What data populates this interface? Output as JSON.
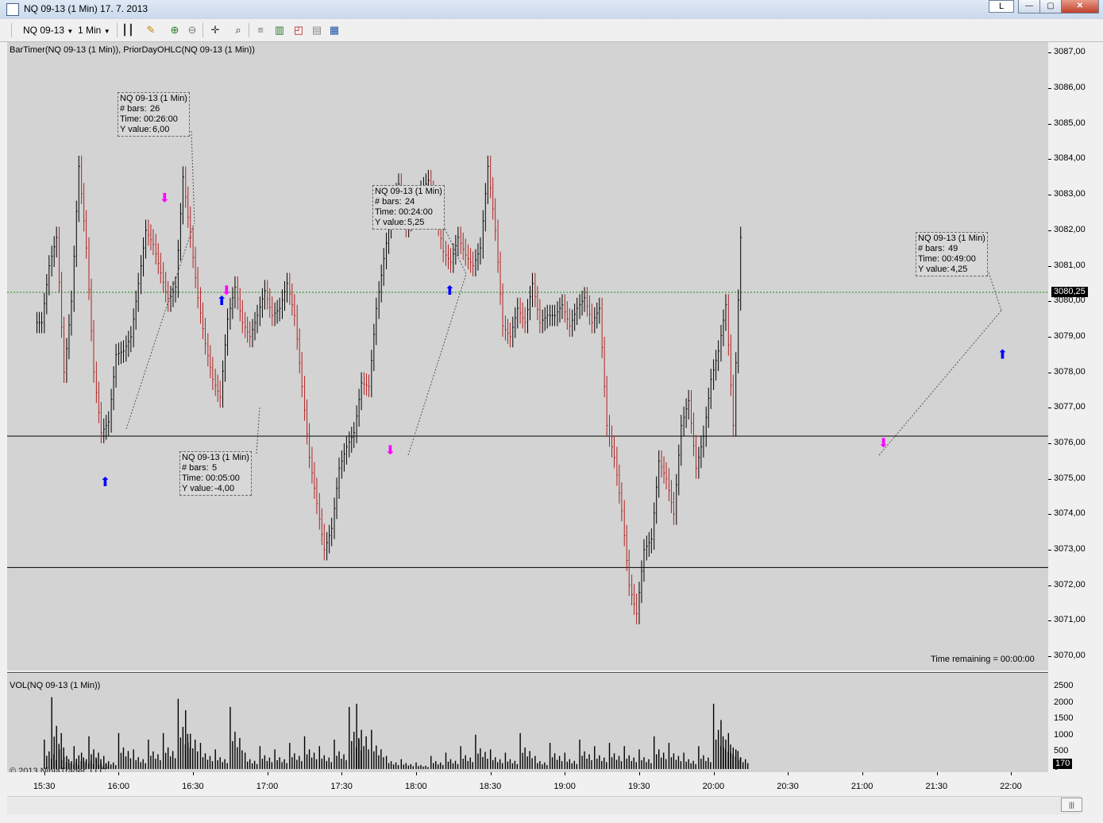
{
  "window": {
    "title": "NQ 09-13 (1 Min)  17. 7. 2013",
    "lock_label": "L"
  },
  "toolbar": {
    "instrument": "NQ 09-13",
    "interval": "1 Min"
  },
  "price_panel": {
    "indicators_label": "BarTimer(NQ 09-13 (1 Min)), PriorDayOHLC(NQ 09-13 (1 Min))",
    "y_ticks": [
      "3087,00",
      "3086,00",
      "3085,00",
      "3084,00",
      "3083,00",
      "3082,00",
      "3081,00",
      "3080,00",
      "3079,00",
      "3078,00",
      "3077,00",
      "3076,00",
      "3075,00",
      "3074,00",
      "3073,00",
      "3072,00",
      "3071,00",
      "3070,00"
    ],
    "current_price": "3080,25",
    "time_remaining": "Time remaining = 00:00:00",
    "tooltips": [
      {
        "title": "NQ 09-13 (1 Min)",
        "bars_label": "# bars:",
        "bars": "26",
        "time_label": "Time:",
        "time": "00:26:00",
        "y_label": "Y value:",
        "y": "6,00"
      },
      {
        "title": "NQ 09-13 (1 Min)",
        "bars_label": "# bars:",
        "bars": "24",
        "time_label": "Time:",
        "time": "00:24:00",
        "y_label": "Y value:",
        "y": "5,25"
      },
      {
        "title": "NQ 09-13 (1 Min)",
        "bars_label": "# bars:",
        "bars": "5",
        "time_label": "Time:",
        "time": "00:05:00",
        "y_label": "Y value:",
        "y": "-4,00"
      },
      {
        "title": "NQ 09-13 (1 Min)",
        "bars_label": "# bars:",
        "bars": "49",
        "time_label": "Time:",
        "time": "00:49:00",
        "y_label": "Y value:",
        "y": "4,25"
      }
    ]
  },
  "volume_panel": {
    "label": "VOL(NQ 09-13 (1 Min))",
    "y_ticks": [
      "2500",
      "2000",
      "1500",
      "1000",
      "500",
      "0"
    ],
    "current_volume": "170",
    "copyright": "© 2013 NinjaTrader, LLC"
  },
  "x_ticks": [
    "15:30",
    "16:00",
    "16:30",
    "17:00",
    "17:30",
    "18:00",
    "18:30",
    "19:00",
    "19:30",
    "20:00",
    "20:30",
    "21:00",
    "21:30",
    "22:00"
  ],
  "colors": {
    "panel_bg": "#d3d3d3",
    "up_bar": "#000000",
    "down_bar": "#b22222",
    "prior_close_line": "#1a8a1a",
    "long_marker": "#0000ff",
    "short_marker": "#ff00ff"
  },
  "chart_data": {
    "type": "line",
    "ylim": [
      3069.6,
      3087.3
    ],
    "prior_day_lines": [
      3076.2,
      3072.5
    ],
    "current_line": 3080.25,
    "close_series": [
      {
        "t": "15:27",
        "v": 3079.4
      },
      {
        "t": "15:30",
        "v": 3081.0
      },
      {
        "t": "15:33",
        "v": 3081.8
      },
      {
        "t": "15:36",
        "v": 3078.0
      },
      {
        "t": "15:39",
        "v": 3080.0
      },
      {
        "t": "15:42",
        "v": 3083.8
      },
      {
        "t": "15:45",
        "v": 3081.5
      },
      {
        "t": "15:48",
        "v": 3078.0
      },
      {
        "t": "15:51",
        "v": 3076.3
      },
      {
        "t": "15:54",
        "v": 3076.6
      },
      {
        "t": "15:57",
        "v": 3078.5
      },
      {
        "t": "16:00",
        "v": 3078.6
      },
      {
        "t": "16:03",
        "v": 3079.0
      },
      {
        "t": "16:06",
        "v": 3080.5
      },
      {
        "t": "16:09",
        "v": 3082.0
      },
      {
        "t": "16:12",
        "v": 3081.6
      },
      {
        "t": "16:15",
        "v": 3080.8
      },
      {
        "t": "16:18",
        "v": 3080.0
      },
      {
        "t": "16:21",
        "v": 3080.4
      },
      {
        "t": "16:24",
        "v": 3083.5
      },
      {
        "t": "16:27",
        "v": 3081.8
      },
      {
        "t": "16:30",
        "v": 3080.1
      },
      {
        "t": "16:33",
        "v": 3078.8
      },
      {
        "t": "16:36",
        "v": 3077.8
      },
      {
        "t": "16:39",
        "v": 3077.3
      },
      {
        "t": "16:42",
        "v": 3079.5
      },
      {
        "t": "16:45",
        "v": 3080.4
      },
      {
        "t": "16:48",
        "v": 3079.4
      },
      {
        "t": "16:51",
        "v": 3079.0
      },
      {
        "t": "16:54",
        "v": 3079.6
      },
      {
        "t": "16:57",
        "v": 3080.3
      },
      {
        "t": "17:00",
        "v": 3079.6
      },
      {
        "t": "17:03",
        "v": 3079.8
      },
      {
        "t": "17:06",
        "v": 3080.5
      },
      {
        "t": "17:09",
        "v": 3079.6
      },
      {
        "t": "17:12",
        "v": 3077.6
      },
      {
        "t": "17:15",
        "v": 3075.6
      },
      {
        "t": "17:18",
        "v": 3074.3
      },
      {
        "t": "17:21",
        "v": 3073.0
      },
      {
        "t": "17:24",
        "v": 3073.6
      },
      {
        "t": "17:27",
        "v": 3075.3
      },
      {
        "t": "17:30",
        "v": 3075.9
      },
      {
        "t": "17:33",
        "v": 3076.3
      },
      {
        "t": "17:36",
        "v": 3077.7
      },
      {
        "t": "17:39",
        "v": 3077.6
      },
      {
        "t": "17:42",
        "v": 3079.8
      },
      {
        "t": "17:45",
        "v": 3081.2
      },
      {
        "t": "17:48",
        "v": 3082.5
      },
      {
        "t": "17:51",
        "v": 3083.3
      },
      {
        "t": "17:54",
        "v": 3082.1
      },
      {
        "t": "17:57",
        "v": 3082.6
      },
      {
        "t": "18:00",
        "v": 3083.1
      },
      {
        "t": "18:03",
        "v": 3083.4
      },
      {
        "t": "18:06",
        "v": 3082.5
      },
      {
        "t": "18:09",
        "v": 3081.4
      },
      {
        "t": "18:12",
        "v": 3081.1
      },
      {
        "t": "18:15",
        "v": 3081.8
      },
      {
        "t": "18:18",
        "v": 3081.3
      },
      {
        "t": "18:21",
        "v": 3081.0
      },
      {
        "t": "18:24",
        "v": 3081.5
      },
      {
        "t": "18:27",
        "v": 3083.8
      },
      {
        "t": "18:30",
        "v": 3082.0
      },
      {
        "t": "18:33",
        "v": 3079.3
      },
      {
        "t": "18:36",
        "v": 3079.0
      },
      {
        "t": "18:39",
        "v": 3079.8
      },
      {
        "t": "18:42",
        "v": 3079.4
      },
      {
        "t": "18:45",
        "v": 3080.5
      },
      {
        "t": "18:48",
        "v": 3079.4
      },
      {
        "t": "18:51",
        "v": 3079.6
      },
      {
        "t": "18:54",
        "v": 3079.6
      },
      {
        "t": "18:57",
        "v": 3079.9
      },
      {
        "t": "19:00",
        "v": 3079.3
      },
      {
        "t": "19:03",
        "v": 3079.8
      },
      {
        "t": "19:06",
        "v": 3080.1
      },
      {
        "t": "19:09",
        "v": 3079.4
      },
      {
        "t": "19:12",
        "v": 3079.8
      },
      {
        "t": "19:15",
        "v": 3076.5
      },
      {
        "t": "19:18",
        "v": 3075.6
      },
      {
        "t": "19:21",
        "v": 3074.1
      },
      {
        "t": "19:24",
        "v": 3072.0
      },
      {
        "t": "19:27",
        "v": 3071.2
      },
      {
        "t": "19:30",
        "v": 3073.0
      },
      {
        "t": "19:33",
        "v": 3073.3
      },
      {
        "t": "19:36",
        "v": 3075.5
      },
      {
        "t": "19:39",
        "v": 3075.0
      },
      {
        "t": "19:42",
        "v": 3074.0
      },
      {
        "t": "19:45",
        "v": 3076.5
      },
      {
        "t": "19:48",
        "v": 3077.2
      },
      {
        "t": "19:51",
        "v": 3075.3
      },
      {
        "t": "19:54",
        "v": 3076.2
      },
      {
        "t": "19:57",
        "v": 3077.8
      },
      {
        "t": "20:00",
        "v": 3078.6
      },
      {
        "t": "20:03",
        "v": 3079.9
      },
      {
        "t": "20:06",
        "v": 3076.5
      },
      {
        "t": "20:09",
        "v": 3081.8
      }
    ],
    "volume": [
      {
        "t": "15:30",
        "v": 900
      },
      {
        "t": "15:33",
        "v": 2200
      },
      {
        "t": "15:36",
        "v": 600
      },
      {
        "t": "15:39",
        "v": 400
      },
      {
        "t": "15:42",
        "v": 700
      },
      {
        "t": "15:45",
        "v": 500
      },
      {
        "t": "15:48",
        "v": 1000
      },
      {
        "t": "15:51",
        "v": 300
      },
      {
        "t": "15:54",
        "v": 400
      },
      {
        "t": "16:00",
        "v": 1100
      },
      {
        "t": "16:06",
        "v": 600
      },
      {
        "t": "16:12",
        "v": 900
      },
      {
        "t": "16:18",
        "v": 1100
      },
      {
        "t": "16:24",
        "v": 2150
      },
      {
        "t": "16:27",
        "v": 1800
      },
      {
        "t": "16:33",
        "v": 800
      },
      {
        "t": "16:39",
        "v": 600
      },
      {
        "t": "16:45",
        "v": 1900
      },
      {
        "t": "16:51",
        "v": 500
      },
      {
        "t": "16:57",
        "v": 700
      },
      {
        "t": "17:03",
        "v": 600
      },
      {
        "t": "17:09",
        "v": 800
      },
      {
        "t": "17:15",
        "v": 1000
      },
      {
        "t": "17:21",
        "v": 700
      },
      {
        "t": "17:27",
        "v": 900
      },
      {
        "t": "17:33",
        "v": 1900
      },
      {
        "t": "17:36",
        "v": 2000
      },
      {
        "t": "17:42",
        "v": 1200
      },
      {
        "t": "17:48",
        "v": 400
      },
      {
        "t": "17:54",
        "v": 300
      },
      {
        "t": "18:00",
        "v": 200
      },
      {
        "t": "18:06",
        "v": 400
      },
      {
        "t": "18:12",
        "v": 500
      },
      {
        "t": "18:18",
        "v": 700
      },
      {
        "t": "18:24",
        "v": 1050
      },
      {
        "t": "18:30",
        "v": 600
      },
      {
        "t": "18:36",
        "v": 500
      },
      {
        "t": "18:42",
        "v": 1100
      },
      {
        "t": "18:48",
        "v": 400
      },
      {
        "t": "18:54",
        "v": 800
      },
      {
        "t": "19:00",
        "v": 500
      },
      {
        "t": "19:06",
        "v": 900
      },
      {
        "t": "19:12",
        "v": 700
      },
      {
        "t": "19:18",
        "v": 800
      },
      {
        "t": "19:24",
        "v": 700
      },
      {
        "t": "19:30",
        "v": 600
      },
      {
        "t": "19:36",
        "v": 1000
      },
      {
        "t": "19:42",
        "v": 800
      },
      {
        "t": "19:48",
        "v": 500
      },
      {
        "t": "19:54",
        "v": 700
      },
      {
        "t": "20:00",
        "v": 2000
      },
      {
        "t": "20:03",
        "v": 1500
      },
      {
        "t": "20:06",
        "v": 1100
      },
      {
        "t": "20:09",
        "v": 600
      }
    ]
  }
}
